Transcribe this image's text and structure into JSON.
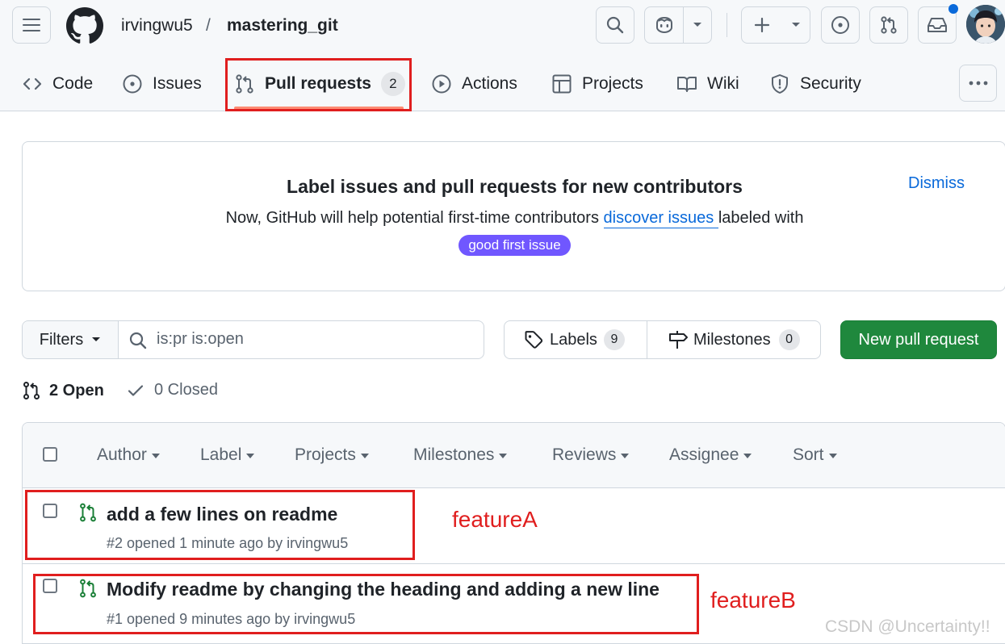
{
  "header": {
    "owner": "irvingwu5",
    "separator": "/",
    "repo": "mastering_git"
  },
  "tabs": [
    {
      "label": "Code",
      "icon": "code-icon"
    },
    {
      "label": "Issues",
      "icon": "issue-opened-icon"
    },
    {
      "label": "Pull requests",
      "icon": "git-pull-request-icon",
      "count": "2",
      "selected": true
    },
    {
      "label": "Actions",
      "icon": "play-icon"
    },
    {
      "label": "Projects",
      "icon": "table-icon"
    },
    {
      "label": "Wiki",
      "icon": "book-icon"
    },
    {
      "label": "Security",
      "icon": "shield-icon"
    }
  ],
  "banner": {
    "title": "Label issues and pull requests for new contributors",
    "text_before": "Now, GitHub will help potential first-time contributors ",
    "link": "discover issues ",
    "text_after": "labeled with",
    "label": "good first issue",
    "dismiss": "Dismiss"
  },
  "controls": {
    "filters": "Filters",
    "search_value": "is:pr is:open",
    "labels": "Labels",
    "labels_count": "9",
    "milestones": "Milestones",
    "milestones_count": "0",
    "new_pr": "New pull request"
  },
  "states": {
    "open": "2 Open",
    "closed": "0 Closed"
  },
  "list_filters": [
    "Author",
    "Label",
    "Projects",
    "Milestones",
    "Reviews",
    "Assignee",
    "Sort"
  ],
  "pull_requests": [
    {
      "title": "add a few lines on readme",
      "meta": "#2 opened 1 minute ago by irvingwu5",
      "annotation": "featureA"
    },
    {
      "title": "Modify readme by changing the heading and adding a new line",
      "meta": "#1 opened 9 minutes ago by irvingwu5",
      "annotation": "featureB"
    }
  ],
  "watermark": "CSDN @Uncertainty!!",
  "colors": {
    "accent_link": "#0969da",
    "success_green": "#1f883d",
    "open_icon_green": "#1a7f37",
    "label_purple": "#7057ff",
    "annotation_red": "#e01e1e",
    "notification_dot": "#0969da"
  }
}
